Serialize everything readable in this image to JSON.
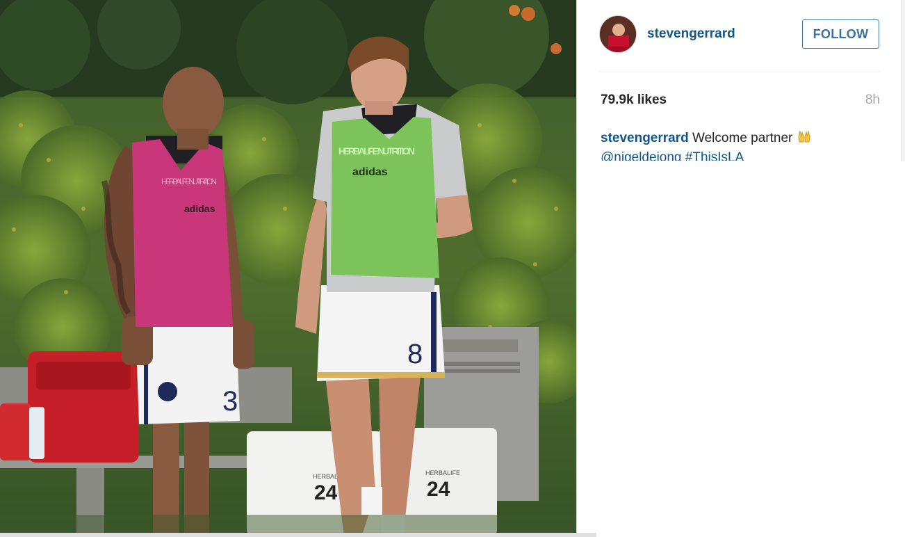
{
  "post": {
    "username": "stevengerrard",
    "follow_label": "FOLLOW",
    "likes": "79.9k likes",
    "time_ago": "8h",
    "caption": {
      "username": "stevengerrard",
      "text": "Welcome partner",
      "emoji_icon": "raised-hands-icon",
      "mention": "@nigeldejong",
      "hashtag": "#ThisIsLA"
    }
  },
  "photo_text": {
    "left_bib_sponsor": "HERBALIFE NUTRITION",
    "left_bib_brand": "adidas",
    "right_bib_sponsor": "HERBALIFE NUTRITION",
    "right_bib_brand": "adidas",
    "left_shorts_number": "3",
    "right_shorts_number": "8",
    "cooler_label_1": "HERBALIFE",
    "cooler_number_1": "24",
    "cooler_label_2": "HERBALIFE",
    "cooler_number_2": "24"
  },
  "colors": {
    "link_blue": "#125688",
    "follow_blue": "#3f729b",
    "text_dark": "#262626",
    "time_gray": "#a5a7aa"
  }
}
